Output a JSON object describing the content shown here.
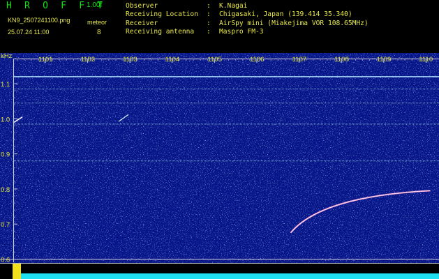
{
  "header": {
    "app_title": "H R O F F T",
    "version": "1.00f",
    "filename": "KN9_2507241100.png",
    "datetime": "25.07.24 11:00",
    "meteor_label": "meteor",
    "meteor_count": "8",
    "info": [
      {
        "label": "Observer",
        "sep": ":",
        "value": "K.Nagai"
      },
      {
        "label": "Receiving Location",
        "sep": ":",
        "value": "Chigasaki, Japan (139.414 35.340)"
      },
      {
        "label": "Receiver",
        "sep": ":",
        "value": "AirSpy mini (Miakejima VOR 108.65MHz)"
      },
      {
        "label": "Receiving antenna",
        "sep": ":",
        "value": "Maspro FM-3"
      }
    ]
  },
  "axes": {
    "y_unit": "kHz",
    "y_ticks": [
      "1.1",
      "1.0",
      "0.9",
      "0.8",
      "0.7",
      "0.6"
    ],
    "y_ticks_values": [
      1.1,
      1.0,
      0.9,
      0.8,
      0.7,
      0.6
    ],
    "x_ticks": [
      "1101",
      "1102",
      "1103",
      "1104",
      "1105",
      "1106",
      "1107",
      "1108",
      "1109",
      "1110"
    ]
  },
  "colors": {
    "background": "#000000",
    "waterfall": "#07178a",
    "text": "#e8e84a",
    "title": "#18e018",
    "grid": "#d8d8d8",
    "signal_line": "#b8f0ff",
    "spectrum": "#1ee0f0"
  },
  "meteor_trail": {
    "start_time": "1106.8",
    "start_freq_khz": 0.675,
    "end_time": "1110.1",
    "end_freq_khz": 0.795
  },
  "constant_lines_khz": [
    1.12,
    1.085,
    1.045,
    0.985,
    0.88
  ]
}
